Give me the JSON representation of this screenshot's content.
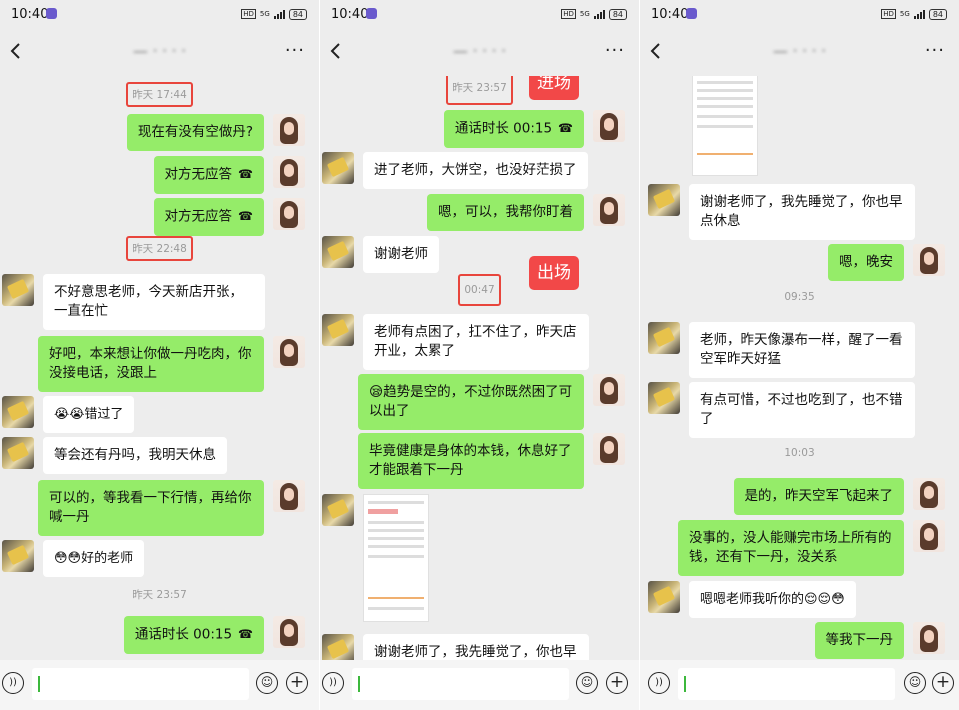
{
  "status_time": "10:40",
  "status_hd": "HD",
  "status_net": "5G",
  "status_battery": "84",
  "contact_name": "— · · · ·",
  "more_glyph": "···",
  "call_icon_glyph": "☎",
  "panels": [
    {
      "messages": [
        {
          "kind": "ts",
          "text": "昨天 17:44",
          "highlight": true
        },
        {
          "kind": "right",
          "text": "现在有没有空做丹?"
        },
        {
          "kind": "right",
          "text": "对方无应答",
          "call": true
        },
        {
          "kind": "right",
          "text": "对方无应答",
          "call": true
        },
        {
          "kind": "ts",
          "text": "昨天 22:48",
          "highlight": true
        },
        {
          "kind": "left",
          "text": "不好意思老师，今天新店开张，一直在忙"
        },
        {
          "kind": "right",
          "text": "好吧，本来想让你做一丹吃肉，你没接电话，没跟上"
        },
        {
          "kind": "left",
          "text": "😭😭错过了"
        },
        {
          "kind": "left",
          "text": "等会还有丹吗，我明天休息"
        },
        {
          "kind": "right",
          "text": "可以的，等我看一下行情，再给你喊一丹"
        },
        {
          "kind": "left",
          "text": "😳😳好的老师"
        },
        {
          "kind": "ts",
          "text": "昨天 23:57",
          "highlight": false
        },
        {
          "kind": "right",
          "text": "通话时长 00:15",
          "call": true
        }
      ]
    },
    {
      "tags": {
        "enter": "进场",
        "exit": "出场"
      },
      "messages": [
        {
          "kind": "ts",
          "text": "昨天 23:57",
          "highlight": true
        },
        {
          "kind": "right",
          "text": "通话时长 00:15",
          "call": true
        },
        {
          "kind": "left",
          "text": "进了老师，大饼空，也没好茫损了"
        },
        {
          "kind": "right",
          "text": "嗯，可以，我帮你盯着"
        },
        {
          "kind": "left",
          "text": "谢谢老师"
        },
        {
          "kind": "ts",
          "text": "00:47",
          "highlight": true
        },
        {
          "kind": "left",
          "text": "老师有点困了，扛不住了，昨天店开业，太累了"
        },
        {
          "kind": "right",
          "text": "😪趋势是空的，不过你既然困了可以出了"
        },
        {
          "kind": "right",
          "text": "毕竟健康是身体的本钱，休息好了才能跟着下一丹"
        },
        {
          "kind": "left",
          "text": ""
        },
        {
          "kind": "left",
          "text": "谢谢老师了，我先睡觉了，你也早"
        }
      ]
    },
    {
      "messages": [
        {
          "kind": "left",
          "text": ""
        },
        {
          "kind": "left",
          "text": "谢谢老师了，我先睡觉了，你也早点休息"
        },
        {
          "kind": "right",
          "text": "嗯，晚安"
        },
        {
          "kind": "ts",
          "text": "09:35",
          "highlight": false
        },
        {
          "kind": "left",
          "text": "老师，昨天像瀑布一样，醒了一看空军昨天好猛"
        },
        {
          "kind": "left",
          "text": "有点可惜，不过也吃到了，也不错了"
        },
        {
          "kind": "ts",
          "text": "10:03",
          "highlight": false
        },
        {
          "kind": "right",
          "text": "是的，昨天空军飞起来了"
        },
        {
          "kind": "right",
          "text": "没事的，没人能赚完市场上所有的钱，还有下一丹，没关系"
        },
        {
          "kind": "left",
          "text": "嗯嗯老师我听你的😌😌😳"
        },
        {
          "kind": "right",
          "text": "等我下一丹"
        }
      ]
    }
  ],
  "input_icons": {
    "voice": "voice-icon",
    "emoji": "emoji-icon",
    "plus": "plus-icon"
  }
}
